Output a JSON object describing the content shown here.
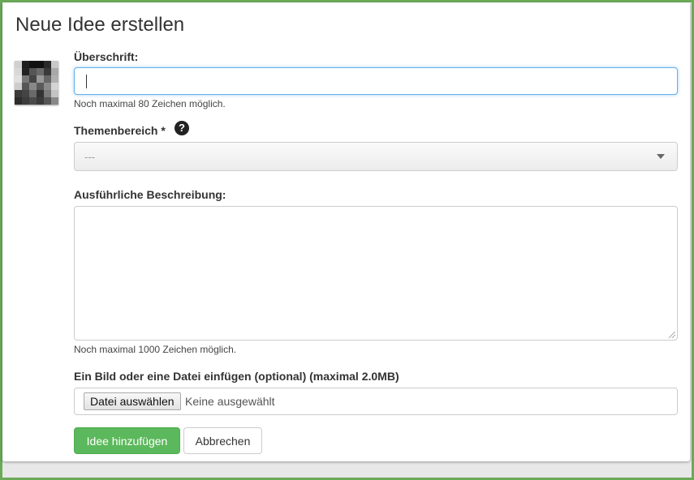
{
  "modal": {
    "title": "Neue Idee erstellen"
  },
  "form": {
    "heading_label": "Überschrift:",
    "heading_value": "",
    "heading_help": "Noch maximal 80 Zeichen möglich.",
    "topic_label": "Themenbereich *",
    "topic_selected": "---",
    "help_icon": "question-circle-icon",
    "description_label": "Ausführliche Beschreibung:",
    "description_value": "",
    "description_help": "Noch maximal 1000 Zeichen möglich.",
    "file_label": "Ein Bild oder eine Datei einfügen (optional) (maximal 2.0MB)",
    "file_button": "Datei auswählen",
    "file_status": "Keine ausgewählt"
  },
  "actions": {
    "submit_label": "Idee hinzufügen",
    "cancel_label": "Abbrechen"
  },
  "colors": {
    "frame_border": "#6aaa58",
    "primary": "#5cb85c",
    "focus": "#66afe9"
  }
}
